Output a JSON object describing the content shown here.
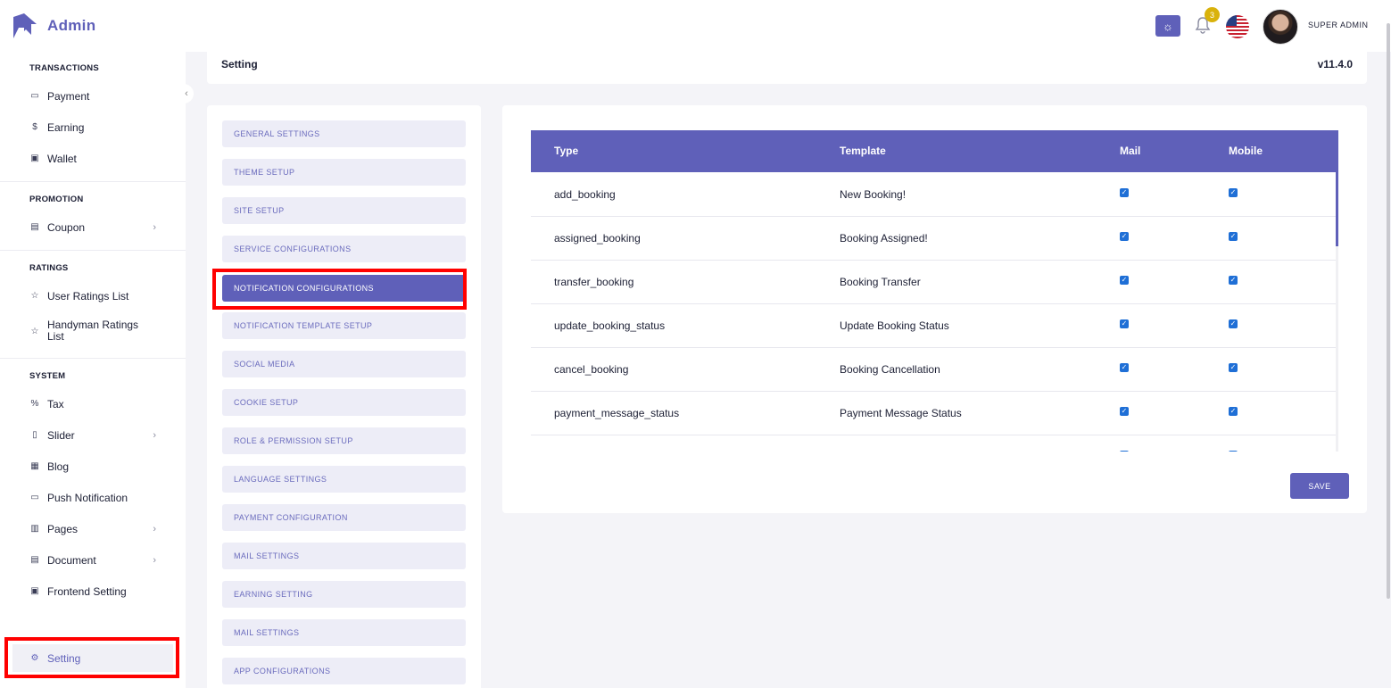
{
  "brand": {
    "title": "Admin"
  },
  "sidebar": {
    "sections": [
      {
        "title": "TRANSACTIONS",
        "items": [
          "Payment",
          "Earning",
          "Wallet"
        ]
      },
      {
        "title": "PROMOTION",
        "items": [
          "Coupon"
        ]
      },
      {
        "title": "RATINGS",
        "items": [
          "User Ratings List",
          "Handyman Ratings List"
        ]
      },
      {
        "title": "SYSTEM",
        "items": [
          "Tax",
          "Slider",
          "Blog",
          "Push Notification",
          "Pages",
          "Document",
          "Frontend Setting",
          "Setting"
        ]
      }
    ]
  },
  "header": {
    "notification_count": "3",
    "user_name": "SUPER ADMIN"
  },
  "breadcrumb": {
    "title": "Setting",
    "version": "v11.4.0"
  },
  "settings_menu": [
    "GENERAL SETTINGS",
    "THEME SETUP",
    "SITE SETUP",
    "SERVICE CONFIGURATIONS",
    "NOTIFICATION CONFIGURATIONS",
    "NOTIFICATION TEMPLATE SETUP",
    "SOCIAL MEDIA",
    "COOKIE SETUP",
    "ROLE & PERMISSION SETUP",
    "LANGUAGE SETTINGS",
    "PAYMENT CONFIGURATION",
    "MAIL SETTINGS",
    "EARNING SETTING",
    "MAIL SETTINGS",
    "APP CONFIGURATIONS"
  ],
  "table": {
    "headers": [
      "Type",
      "Template",
      "Mail",
      "Mobile"
    ],
    "rows": [
      {
        "type": "add_booking",
        "template": "New Booking!",
        "mail": true,
        "mobile": true
      },
      {
        "type": "assigned_booking",
        "template": "Booking Assigned!",
        "mail": true,
        "mobile": true
      },
      {
        "type": "transfer_booking",
        "template": "Booking Transfer",
        "mail": true,
        "mobile": true
      },
      {
        "type": "update_booking_status",
        "template": "Update Booking Status",
        "mail": true,
        "mobile": true
      },
      {
        "type": "cancel_booking",
        "template": "Booking Cancellation",
        "mail": true,
        "mobile": true
      },
      {
        "type": "payment_message_status",
        "template": "Payment Message Status",
        "mail": true,
        "mobile": true
      }
    ],
    "save_label": "SAVE"
  }
}
